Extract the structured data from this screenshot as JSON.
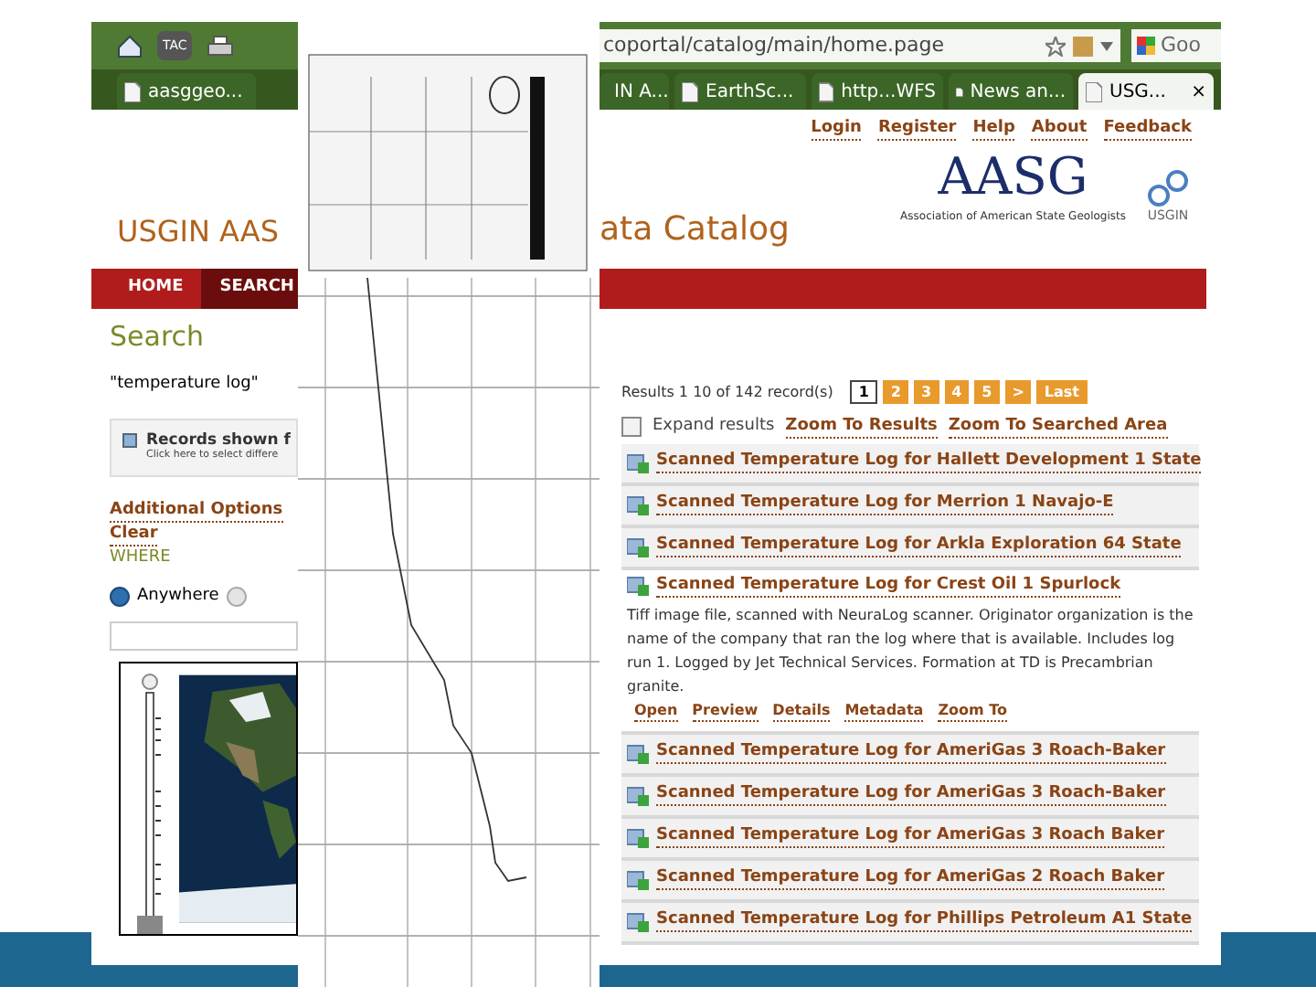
{
  "browser": {
    "toolbar_badge": "TAC",
    "address": "coportal/catalog/main/home.page",
    "search": "Goo",
    "tabs": [
      {
        "label": "aasggeo...",
        "selected": false
      },
      {
        "label": "IN A...",
        "selected": false
      },
      {
        "label": "EarthSc...",
        "selected": false
      },
      {
        "label": "http...WFS",
        "selected": false
      },
      {
        "label": "News an...",
        "selected": false
      },
      {
        "label": "USG...",
        "selected": true
      }
    ],
    "close_tab": "×"
  },
  "top_links": [
    "Login",
    "Register",
    "Help",
    "About",
    "Feedback"
  ],
  "logo": {
    "wordmark": "AASG",
    "tagline": "Association of American State Geologists",
    "partner": "USGIN"
  },
  "title_parts": [
    "USGIN AAS",
    "ata Catalog"
  ],
  "nav": [
    {
      "label": "HOME",
      "selected": false
    },
    {
      "label": "SEARCH",
      "selected": true
    }
  ],
  "search": {
    "heading": "Search",
    "query": "\"temperature log\"",
    "records_title": "Records shown f",
    "records_hint": "Click here to select differe",
    "options_link": "Additional Options",
    "clear_link": "Clear",
    "where_label": "WHERE",
    "where_options": [
      {
        "label": "Anywhere",
        "selected": true
      },
      {
        "selected": false
      }
    ],
    "map": {
      "zoom": {
        "level": 0
      }
    }
  },
  "results": {
    "summary": "Results 1 10 of 142 record(s)",
    "pages": [
      {
        "label": "1",
        "selected": true
      },
      {
        "label": "2",
        "selected": false
      },
      {
        "label": "3",
        "selected": false
      },
      {
        "label": "4",
        "selected": false
      },
      {
        "label": "5",
        "selected": false
      },
      {
        "label": ">",
        "selected": false
      },
      {
        "label": "Last",
        "selected": false
      }
    ],
    "expand": {
      "label": "Expand results",
      "checked": false
    },
    "zoom_links": [
      "Zoom To Results",
      "Zoom To Searched Area"
    ],
    "records": [
      {
        "title": "Scanned Temperature Log for Hallett Development 1 State",
        "expanded": false
      },
      {
        "title": "Scanned Temperature Log for Merrion 1 Navajo-E",
        "expanded": false
      },
      {
        "title": "Scanned Temperature Log for Arkla Exploration 64 State",
        "expanded": false
      },
      {
        "title": "Scanned Temperature Log for Crest Oil 1 Spurlock",
        "expanded": true,
        "description": "Tiff image file, scanned with NeuraLog scanner. Originator organization is the name of the company that ran the log where that is available. Includes log run 1. Logged by Jet Technical Services. Formation at TD is Precambrian granite.",
        "actions": [
          "Open",
          "Preview",
          "Details",
          "Metadata",
          "Zoom To"
        ]
      },
      {
        "title": "Scanned Temperature Log for AmeriGas 3 Roach-Baker",
        "expanded": false
      },
      {
        "title": "Scanned Temperature Log for AmeriGas 3 Roach-Baker",
        "expanded": false
      },
      {
        "title": "Scanned Temperature Log for AmeriGas 3 Roach Baker",
        "expanded": false
      },
      {
        "title": "Scanned Temperature Log for AmeriGas 2 Roach Baker",
        "expanded": false
      },
      {
        "title": "Scanned Temperature Log for Phillips Petroleum A1 State",
        "expanded": false
      }
    ]
  }
}
